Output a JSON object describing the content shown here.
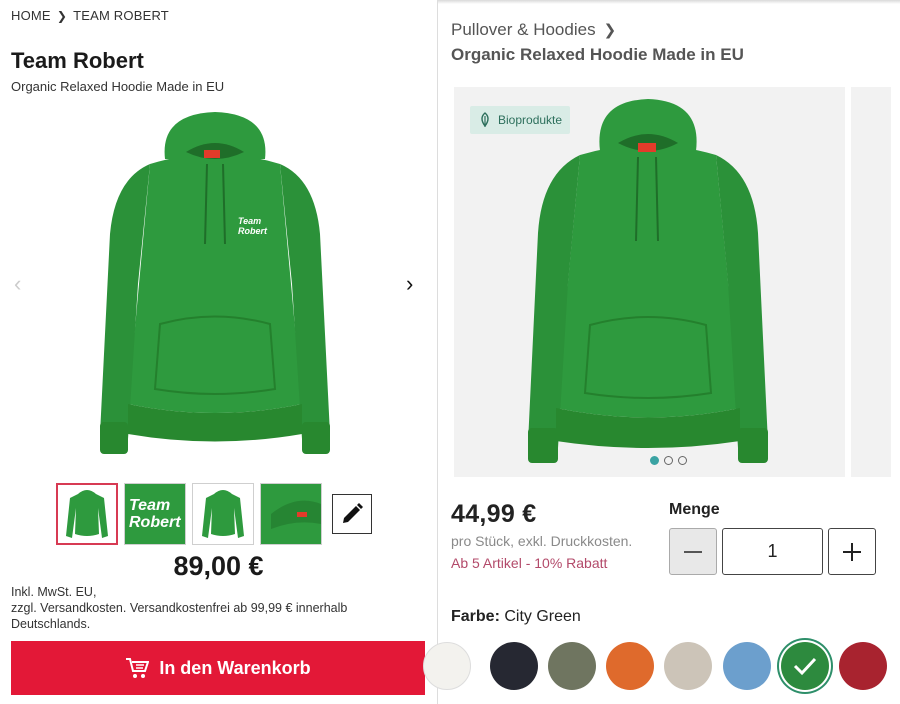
{
  "left": {
    "breadcrumb": {
      "home": "HOME",
      "current": "TEAM ROBERT"
    },
    "title": "Team Robert",
    "subtitle": "Organic Relaxed Hoodie Made in EU",
    "print_text_line1": "Team",
    "print_text_line2": "Robert",
    "thumbnails": [
      {
        "type": "hoodie-front",
        "active": true
      },
      {
        "type": "print-closeup",
        "text_line1": "Team",
        "text_line2": "Robert"
      },
      {
        "type": "hoodie-back"
      },
      {
        "type": "detail-closeup"
      }
    ],
    "price": "89,00 €",
    "tax_info": {
      "line1": "Inkl. MwSt. EU,",
      "line2": "zzgl. Versandkosten. Versandkostenfrei ab 99,99 € innerhalb Deutschlands."
    },
    "cart_button": "In den Warenkorb"
  },
  "right": {
    "category": "Pullover & Hoodies",
    "title": "Organic Relaxed Hoodie Made in EU",
    "badge": "Bioprodukte",
    "gallery": {
      "dots": 3,
      "active_index": 0
    },
    "price": "44,99 €",
    "unit_note": "pro Stück, exkl. Druckkosten.",
    "discount": "Ab 5 Artikel - 10% Rabatt",
    "quantity_label": "Menge",
    "quantity_value": "1",
    "color_label": "Farbe:",
    "color_value": "City Green",
    "swatches": [
      {
        "color": "#f3f2ee",
        "selected": false
      },
      {
        "color": "#262832",
        "selected": false
      },
      {
        "color": "#6f7560",
        "selected": false
      },
      {
        "color": "#df6a2c",
        "selected": false
      },
      {
        "color": "#ccc4b8",
        "selected": false
      },
      {
        "color": "#6c9fcd",
        "selected": false
      },
      {
        "color": "#2d8a3e",
        "selected": true
      },
      {
        "color": "#a8232f",
        "selected": false
      }
    ]
  },
  "colors": {
    "hoodie_green": "#2e9a3e",
    "cart_red": "#e31837",
    "active_thumb_border": "#d73a53",
    "badge_bg": "#d9ece6",
    "discount_text": "#b34a6a"
  }
}
